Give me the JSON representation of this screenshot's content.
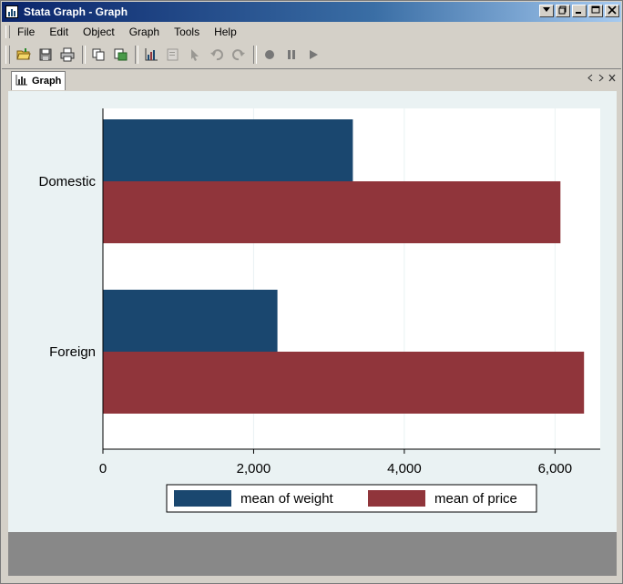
{
  "window": {
    "title": "Stata Graph - Graph",
    "controls": [
      "minimize",
      "maximize",
      "close"
    ]
  },
  "menu": {
    "items": [
      "File",
      "Edit",
      "Object",
      "Graph",
      "Tools",
      "Help"
    ]
  },
  "toolbar": {
    "buttons": [
      "open-graph",
      "save",
      "print",
      "copy",
      "rename",
      "graph-editor",
      "select",
      "add-text",
      "undo",
      "redo",
      "record",
      "pause",
      "play"
    ]
  },
  "tab": {
    "label": "Graph"
  },
  "chart_data": {
    "type": "bar",
    "orientation": "horizontal",
    "categories": [
      "Domestic",
      "Foreign"
    ],
    "series": [
      {
        "name": "mean of weight",
        "values": [
          3317,
          2316
        ],
        "color": "#1a476f"
      },
      {
        "name": "mean of price",
        "values": [
          6072,
          6385
        ],
        "color": "#90353b"
      }
    ],
    "xlim": [
      0,
      6600
    ],
    "xticks": [
      "0",
      "2,000",
      "4,000",
      "6,000"
    ],
    "xtick_values": [
      0,
      2000,
      4000,
      6000
    ],
    "grid": true,
    "legend_position": "bottom"
  },
  "colors": {
    "plot_background": "#ffffff",
    "graph_background": "#eaf2f3",
    "status_area": "#888888"
  }
}
